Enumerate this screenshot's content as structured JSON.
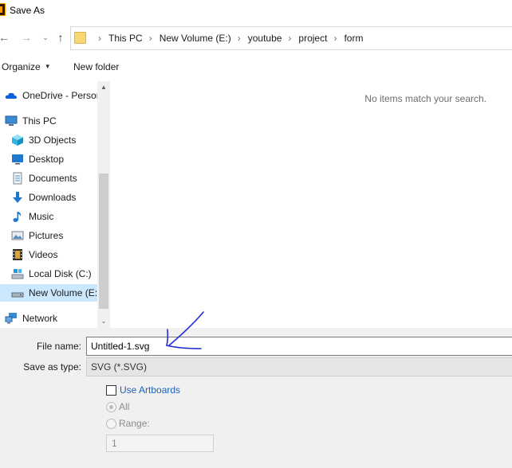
{
  "window": {
    "title": "Save As"
  },
  "nav": {
    "back_icon": "arrow-left-icon",
    "forward_icon": "arrow-right-icon",
    "history_icon": "chevron-down-icon",
    "up_icon": "arrow-up-icon",
    "breadcrumbs": [
      "This PC",
      "New Volume (E:)",
      "youtube",
      "project",
      "form"
    ]
  },
  "toolbar": {
    "organize_label": "Organize",
    "new_folder_label": "New folder"
  },
  "sidebar": {
    "items": [
      {
        "label": "OneDrive - Person",
        "icon": "cloud-icon"
      },
      {
        "label": "This PC",
        "icon": "computer-icon"
      },
      {
        "label": "3D Objects",
        "icon": "cube-icon"
      },
      {
        "label": "Desktop",
        "icon": "desktop-icon"
      },
      {
        "label": "Documents",
        "icon": "document-icon"
      },
      {
        "label": "Downloads",
        "icon": "download-icon"
      },
      {
        "label": "Music",
        "icon": "music-note-icon"
      },
      {
        "label": "Pictures",
        "icon": "picture-icon"
      },
      {
        "label": "Videos",
        "icon": "film-icon"
      },
      {
        "label": "Local Disk (C:)",
        "icon": "disk-icon"
      },
      {
        "label": "New Volume (E:)",
        "icon": "drive-icon",
        "selected": true
      },
      {
        "label": "Network",
        "icon": "network-icon"
      }
    ]
  },
  "content": {
    "empty_message": "No items match your search."
  },
  "form": {
    "file_name_label": "File name:",
    "file_name_value": "Untitled-1.svg",
    "save_type_label": "Save as type:",
    "save_type_value": "SVG (*.SVG)",
    "use_artboards_label": "Use Artboards",
    "use_artboards_checked": false,
    "radio_all_label": "All",
    "radio_range_label": "Range:",
    "range_value": "1"
  },
  "colors": {
    "selected_bg": "#cce8ff",
    "link_blue": "#1a62b8",
    "annotation_blue": "#1f2fd0",
    "panel_bg": "#f0f0f0"
  }
}
